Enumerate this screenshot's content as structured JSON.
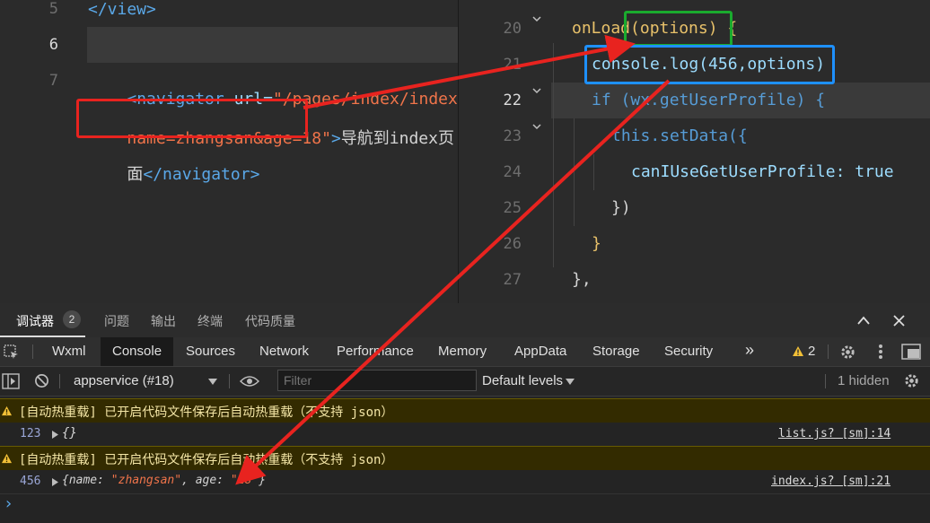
{
  "left_editor": {
    "lines": [
      {
        "num": "5",
        "code": "</view>"
      },
      {
        "num": "6",
        "code": ""
      },
      {
        "num": "7",
        "code_parts": [
          "<navigator ",
          "url=",
          "\"/pages/index/index?",
          "name=zhangsan&age=18\"",
          ">",
          "导航到index页",
          "面",
          "</navigator>"
        ]
      }
    ]
  },
  "right_editor": {
    "lines": [
      {
        "num": "20",
        "text": "onLoad(options) {"
      },
      {
        "num": "21",
        "text": "console.log(456,options)"
      },
      {
        "num": "22",
        "text": "if (wx.getUserProfile) {"
      },
      {
        "num": "23",
        "text": "this.setData({"
      },
      {
        "num": "24",
        "text": "canIUseGetUserProfile: true"
      },
      {
        "num": "25",
        "text": "})"
      },
      {
        "num": "26",
        "text": "}"
      },
      {
        "num": "27",
        "text": "},"
      }
    ]
  },
  "devtools": {
    "top_tabs": [
      "调试器",
      "问题",
      "输出",
      "终端",
      "代码质量"
    ],
    "top_badge": "2",
    "panel_tabs": [
      "Wxml",
      "Console",
      "Sources",
      "Network",
      "Performance",
      "Memory",
      "AppData",
      "Storage",
      "Security"
    ],
    "active_panel": "Console",
    "more_tabs": "»",
    "warning_count": "2",
    "context_select": "appservice (#18)",
    "filter_placeholder": "Filter",
    "levels_select": "Default levels",
    "hidden_count": "1 hidden",
    "messages": [
      {
        "type": "warn",
        "text": "[自动热重载] 已开启代码文件保存后自动热重载（不支持 json）"
      },
      {
        "type": "log",
        "num": "123",
        "text": "{}",
        "source": "list.js? [sm]:14"
      },
      {
        "type": "warn",
        "text": "[自动热重载] 已开启代码文件保存后自动热重载（不支持 json）"
      },
      {
        "type": "log",
        "num": "456",
        "text_parts": [
          "{name: ",
          "\"zhangsan\"",
          ", age: ",
          "\"18\"",
          "}"
        ],
        "source": "index.js? [sm]:21"
      }
    ],
    "prompt": "›"
  },
  "colors": {
    "green_box": "#1aab2e",
    "blue_box": "#1e90ff",
    "red_box": "#e8231f",
    "arrow": "#e8231f"
  }
}
